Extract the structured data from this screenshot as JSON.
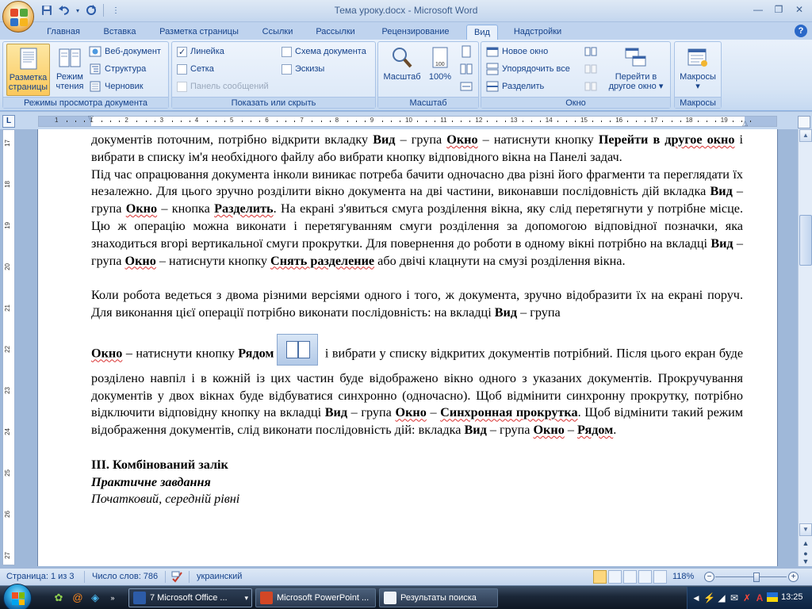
{
  "window": {
    "title": "Тема уроку.docx - Microsoft Word"
  },
  "qat": {
    "icons": [
      "save-icon",
      "undo-icon",
      "redo-icon",
      "customize-icon"
    ]
  },
  "tabs": [
    {
      "label": "Главная",
      "active": false
    },
    {
      "label": "Вставка",
      "active": false
    },
    {
      "label": "Разметка страницы",
      "active": false
    },
    {
      "label": "Ссылки",
      "active": false
    },
    {
      "label": "Рассылки",
      "active": false
    },
    {
      "label": "Рецензирование",
      "active": false
    },
    {
      "label": "Вид",
      "active": true
    },
    {
      "label": "Надстройки",
      "active": false
    }
  ],
  "ribbon": {
    "views": {
      "group_label": "Режимы просмотра документа",
      "print_layout_line1": "Разметка",
      "print_layout_line2": "страницы",
      "reading_line1": "Режим",
      "reading_line2": "чтения",
      "web": "Веб-документ",
      "outline": "Структура",
      "draft": "Черновик"
    },
    "show_hide": {
      "group_label": "Показать или скрыть",
      "ruler": "Линейка",
      "gridlines": "Сетка",
      "message_bar": "Панель сообщений",
      "doc_map": "Схема документа",
      "thumbnails": "Эскизы",
      "ruler_checked": true,
      "gridlines_checked": false,
      "message_bar_checked": false,
      "doc_map_checked": false,
      "thumbnails_checked": false
    },
    "zoom": {
      "group_label": "Масштаб",
      "zoom": "Масштаб",
      "hundred": "100%"
    },
    "window": {
      "group_label": "Окно",
      "new_window": "Новое окно",
      "arrange_all": "Упорядочить все",
      "split": "Разделить",
      "switch_line1": "Перейти в",
      "switch_line2": "другое окно"
    },
    "macros": {
      "group_label": "Макросы",
      "macros": "Макросы"
    }
  },
  "document": {
    "p1_a": "документів поточним, потрібно відкрити вкладку ",
    "p1_b": "Вид",
    "p1_c": " – група ",
    "p1_d": "Окно",
    "p1_e": " – натиснути кнопку ",
    "p1_f": "Перейти в",
    "p1_g": "другое окно",
    "p1_h": "  і вибрати в списку ім'я необхідного файлу або вибрати кнопку відповідного вікна на Панелі задач.",
    "p2_a": "Під час опрацювання документа інколи виникає потреба бачити одночасно два різні його фрагменти та переглядати їх незалежно. Для цього зручно розділити вікно документа на дві частини, виконавши послідовність дій вкладка ",
    "p2_b": "Вид",
    "p2_c": " – група ",
    "p2_d": "Окно",
    "p2_e": " – кнопка ",
    "p2_f": "Разделить",
    "p2_g": ". На екрані з'явиться смуга розділення вікна, яку слід перетягнути у потрібне місце. Цю ж операцію можна виконати і перетягуванням смуги розділення за допомогою відповідної позначки, яка знаходиться вгорі вертикальної смуги прокрутки. Для повернення до роботи в одному вікні потрібно на вкладці ",
    "p2_h": "Вид",
    "p2_i": " – група ",
    "p2_j": "Окно",
    "p2_k": " – натиснути кнопку ",
    "p2_l": "Снять разделение",
    "p2_m": " або двічі клацнути на смузі розділення вікна.",
    "p3_a": "Коли робота ведеться з двома різними версіями одного і того, ж документа, зручно відобразити їх на екрані поруч. Для виконання цієї операції потрібно виконати послідовність: на вкладці ",
    "p3_b": "Вид",
    "p3_c": " – група",
    "p3_d": "Окно",
    "p3_e": " – натиснути кнопку ",
    "p3_f": "Рядом",
    "p3_g": " і вибрати у списку відкритих документів потрібний. Після цього екран буде розділено навпіл і в кожній із цих частин буде відображено вікно одного з указаних документів. Прокручування документів у двох вікнах буде відбуватися синхронно (одночасно). Щоб відмінити синхронну прокрутку, потрібно відключити відповідну кнопку на вкладці ",
    "p3_h": "Вид",
    "p3_i": " – група ",
    "p3_j": "Окно",
    "p3_k": " – ",
    "p3_l": "Синхронная прокрутка",
    "p3_m": ". Щоб відмінити такий режим відображення документів, слід виконати послідовність дій: вкладка ",
    "p3_n": "Вид",
    "p3_o": "  – група ",
    "p3_p": "Окно",
    "p3_q": " – ",
    "p3_r": "Рядом",
    "p3_s": ".",
    "h1": "ІІІ. Комбінований залік",
    "h2": "Практичне завдання",
    "h3": "Початковий, середній рівні"
  },
  "ruler": {
    "h_labels": [
      "1",
      "1",
      "2",
      "3",
      "4",
      "5",
      "6",
      "7",
      "8",
      "9",
      "10",
      "11",
      "12",
      "13",
      "14",
      "15",
      "16",
      "17",
      "18",
      "19"
    ],
    "v_labels": [
      "17",
      "18",
      "19",
      "20",
      "21",
      "22",
      "23",
      "24",
      "25",
      "26",
      "27"
    ]
  },
  "status": {
    "page": "Страница: 1 из 3",
    "words": "Число слов: 786",
    "language": "украинский",
    "zoom": "118%"
  },
  "taskbar": {
    "word_btn": "7 Microsoft Office ...",
    "ppt_btn": "Microsoft PowerPoint ...",
    "search_btn": "Результаты поиска",
    "time": "13:25"
  },
  "colors": {
    "accent": "#15428b",
    "ribbon": "#dae7f7",
    "active_btn": "#fbc85c"
  }
}
